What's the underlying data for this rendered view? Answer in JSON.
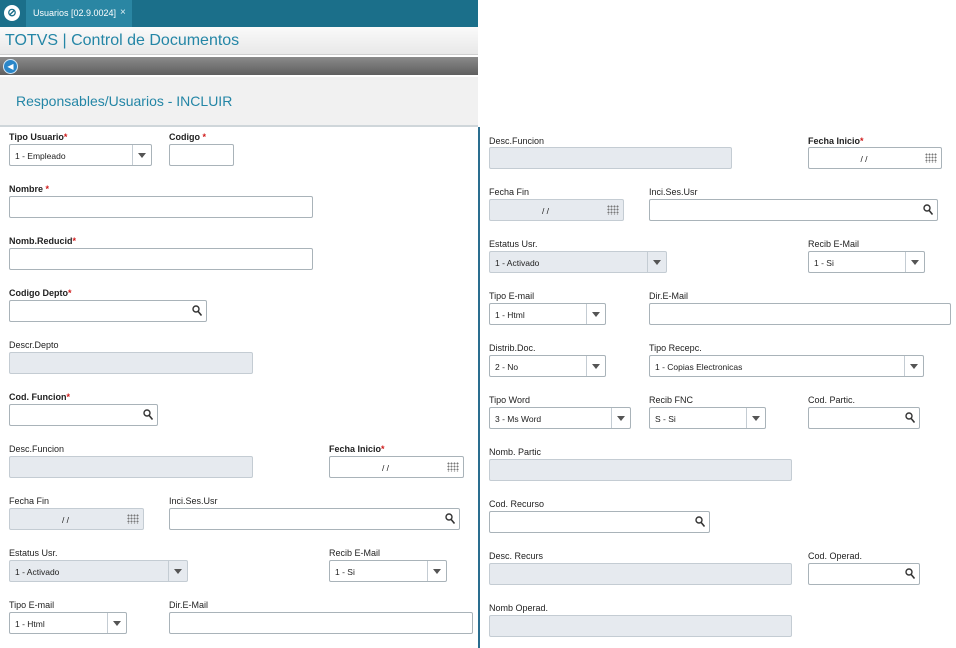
{
  "window": {
    "tab_label": "Usuarios [02.9.0024]",
    "tab_close": "×"
  },
  "app": {
    "title": "TOTVS | Control de Documentos"
  },
  "page": {
    "title": "Responsables/Usuarios - INCLUIR"
  },
  "left": {
    "tipo_usuario": {
      "label": "Tipo Usuario",
      "value": "1 - Empleado"
    },
    "codigo": {
      "label": "Codigo",
      "value": ""
    },
    "nombre": {
      "label": "Nombre",
      "value": ""
    },
    "nomb_reducid": {
      "label": "Nomb.Reducid",
      "value": ""
    },
    "codigo_depto": {
      "label": "Codigo Depto",
      "value": ""
    },
    "descr_depto": {
      "label": "Descr.Depto",
      "value": ""
    },
    "cod_funcion": {
      "label": "Cod. Funcion",
      "value": ""
    },
    "desc_funcion": {
      "label": "Desc.Funcion",
      "value": ""
    },
    "fecha_inicio": {
      "label": "Fecha Inicio",
      "value": "/ /"
    },
    "fecha_fin": {
      "label": "Fecha Fin",
      "value": "/ /"
    },
    "inci_ses_usr": {
      "label": "Inci.Ses.Usr",
      "value": ""
    },
    "estatus_usr": {
      "label": "Estatus Usr.",
      "value": "1 - Activado"
    },
    "recib_email": {
      "label": "Recib E-Mail",
      "value": "1 - Si"
    },
    "tipo_email": {
      "label": "Tipo E-mail",
      "value": "1 - Html"
    },
    "dir_email": {
      "label": "Dir.E-Mail",
      "value": ""
    }
  },
  "right": {
    "desc_funcion": {
      "label": "Desc.Funcion",
      "value": ""
    },
    "fecha_inicio": {
      "label": "Fecha Inicio",
      "value": "/ /"
    },
    "fecha_fin": {
      "label": "Fecha Fin",
      "value": "/ /"
    },
    "inci_ses_usr": {
      "label": "Inci.Ses.Usr",
      "value": ""
    },
    "estatus_usr": {
      "label": "Estatus Usr.",
      "value": "1 - Activado"
    },
    "recib_email": {
      "label": "Recib E-Mail",
      "value": "1 - Si"
    },
    "tipo_email": {
      "label": "Tipo E-mail",
      "value": "1 - Html"
    },
    "dir_email": {
      "label": "Dir.E-Mail",
      "value": ""
    },
    "distrib_doc": {
      "label": "Distrib.Doc.",
      "value": "2 - No"
    },
    "tipo_recepc": {
      "label": "Tipo Recepc.",
      "value": "1 - Copias Electronicas"
    },
    "tipo_word": {
      "label": "Tipo Word",
      "value": "3 - Ms Word"
    },
    "recib_fnc": {
      "label": "Recib FNC",
      "value": "S - Si"
    },
    "cod_partic": {
      "label": "Cod. Partic.",
      "value": ""
    },
    "nomb_partic": {
      "label": "Nomb. Partic",
      "value": ""
    },
    "cod_recurso": {
      "label": "Cod. Recurso",
      "value": ""
    },
    "desc_recurs": {
      "label": "Desc. Recurs",
      "value": ""
    },
    "cod_operad": {
      "label": "Cod. Operad.",
      "value": ""
    },
    "nomb_operad": {
      "label": "Nomb Operad.",
      "value": ""
    }
  },
  "required_marker": "*",
  "colors": {
    "brand": "#1b6f8a",
    "accent": "#2486a6",
    "required": "#d01a1a",
    "readonly": "#e6eaef"
  },
  "icons": {
    "logo": "totvs-logo-icon",
    "search": "search-icon",
    "calendar": "calendar-icon",
    "dropdown": "chevron-down-icon"
  }
}
